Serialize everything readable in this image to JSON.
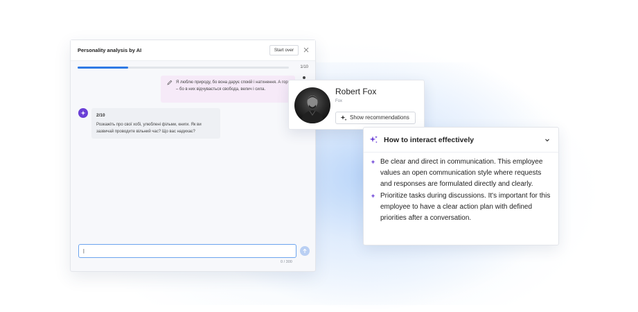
{
  "chat": {
    "title": "Personality analysis by AI",
    "start_over_label": "Start over",
    "progress_label": "1/10",
    "progress_fraction": 0.24,
    "user_message": "Я люблю природу, бо вона дарує спокій і натхнення. А гори – бо в них відчувається свобода, велич і сила.",
    "ai_step": "2/10",
    "ai_message": "Розкажіть про свої хобі, улюблені фільми, книги. Як ви зазвичай проводите вільний час? Що вас надихає?",
    "input_value": "|",
    "char_count": "0 / 300"
  },
  "profile": {
    "name": "Robert Fox",
    "subtitle": "Fox",
    "button_label": "Show recommendations"
  },
  "recommendations": {
    "title": "How to interact effectively",
    "items": [
      "Be clear and direct in communication. This employee values an open communication style where requests and responses are formulated directly and clearly.",
      "Prioritize tasks during discussions. It's important for this employee to have a clear action plan with defined priorities after a conversation."
    ]
  },
  "colors": {
    "accent": "#2f7ae5",
    "ai_purple": "#6a3fd6",
    "user_bubble": "#f6eaf8"
  }
}
